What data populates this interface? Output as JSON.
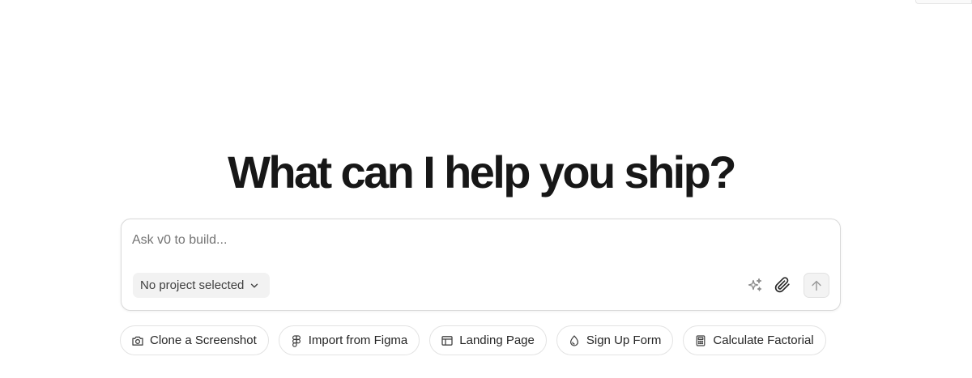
{
  "heading": "What can I help you ship?",
  "composer": {
    "placeholder": "Ask v0 to build...",
    "project_label": "No project selected"
  },
  "icons": {
    "enhance": "sparkle-icon",
    "attach": "paperclip-icon",
    "send": "arrow-up-icon",
    "project_dropdown": "chevron-down-icon"
  },
  "suggestions": [
    {
      "label": "Clone a Screenshot",
      "icon": "camera-icon"
    },
    {
      "label": "Import from Figma",
      "icon": "figma-icon"
    },
    {
      "label": "Landing Page",
      "icon": "layout-icon"
    },
    {
      "label": "Sign Up Form",
      "icon": "droplet-icon"
    },
    {
      "label": "Calculate Factorial",
      "icon": "calculator-icon"
    }
  ]
}
